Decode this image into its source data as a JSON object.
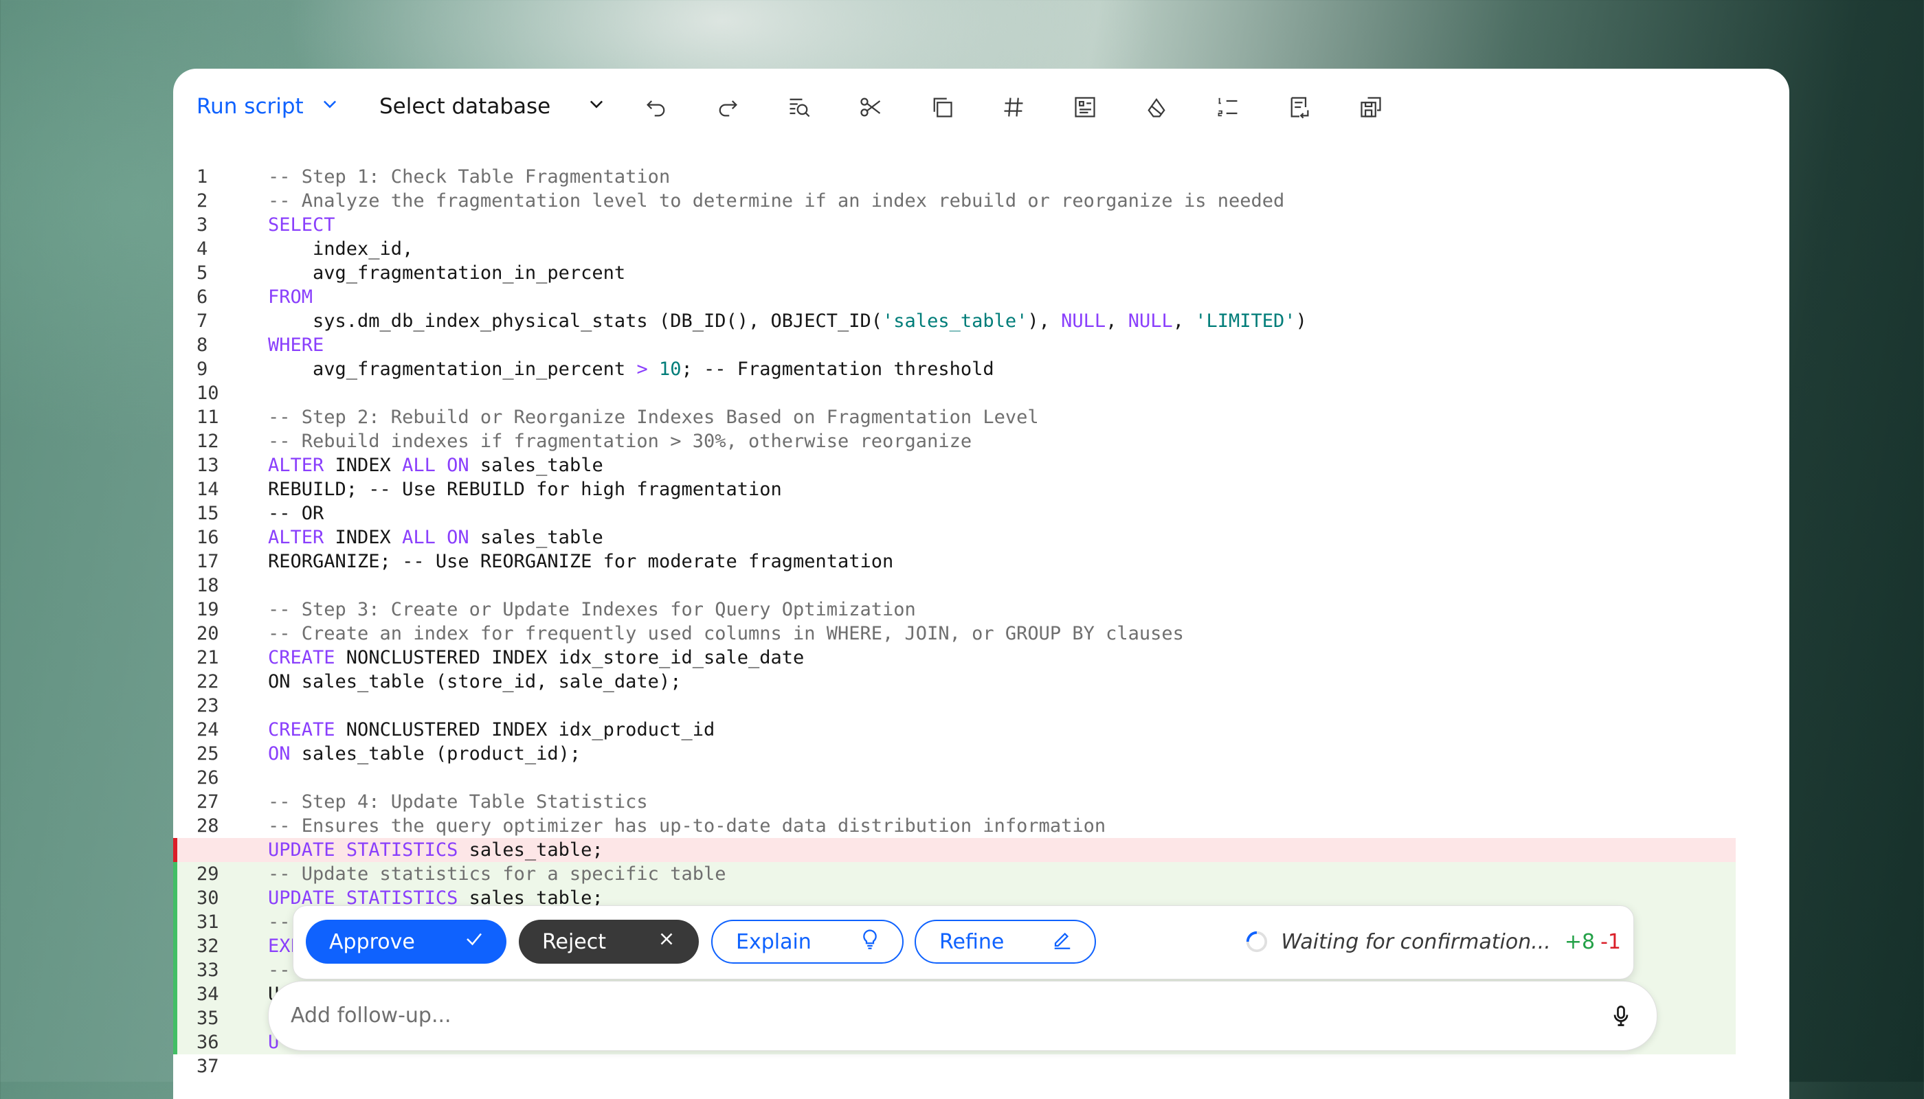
{
  "toolbar": {
    "run_label": "Run script",
    "database_label": "Select database",
    "icons": [
      "undo-icon",
      "redo-icon",
      "find-replace-icon",
      "cut-icon",
      "copy-icon",
      "hashtag-icon",
      "data-format-icon",
      "clear-format-icon",
      "list-numbered-icon",
      "document-import-icon",
      "save-as-icon"
    ]
  },
  "editor": {
    "lines": [
      {
        "n": "1",
        "type": "normal",
        "html": "<span class=\"c\">-- Step 1: Check Table Fragmentation</span>"
      },
      {
        "n": "2",
        "type": "normal",
        "html": "<span class=\"c\">-- Analyze the fragmentation level to determine if an index rebuild or reorganize is needed</span>"
      },
      {
        "n": "3",
        "type": "normal",
        "html": "<span class=\"k\">SELECT</span>"
      },
      {
        "n": "4",
        "type": "normal",
        "html": "    index_id,"
      },
      {
        "n": "5",
        "type": "normal",
        "html": "    avg_fragmentation_in_percent"
      },
      {
        "n": "6",
        "type": "normal",
        "html": "<span class=\"k\">FROM</span>"
      },
      {
        "n": "7",
        "type": "normal",
        "html": "    sys.dm_db_index_physical_stats (DB_ID(), OBJECT_ID(<span class=\"s\">'sales_table'</span>), <span class=\"k\">NULL</span>, <span class=\"k\">NULL</span>, <span class=\"s\">'LIMITED'</span>)"
      },
      {
        "n": "8",
        "type": "normal",
        "html": "<span class=\"k\">WHERE</span>"
      },
      {
        "n": "9",
        "type": "normal",
        "html": "    avg_fragmentation_in_percent <span class=\"k\">&gt;</span> <span class=\"n\">10</span>; -- Fragmentation threshold"
      },
      {
        "n": "10",
        "type": "normal",
        "html": ""
      },
      {
        "n": "11",
        "type": "normal",
        "html": "<span class=\"c\">-- Step 2: Rebuild or Reorganize Indexes Based on Fragmentation Level</span>"
      },
      {
        "n": "12",
        "type": "normal",
        "html": "<span class=\"c\">-- Rebuild indexes if fragmentation &gt; 30%, otherwise reorganize</span>"
      },
      {
        "n": "13",
        "type": "normal",
        "html": "<span class=\"k\">ALTER</span> INDEX <span class=\"k\">ALL</span> <span class=\"k\">ON</span> sales_table"
      },
      {
        "n": "14",
        "type": "normal",
        "html": "REBUILD; -- Use REBUILD for high fragmentation"
      },
      {
        "n": "15",
        "type": "normal",
        "html": "-- OR"
      },
      {
        "n": "16",
        "type": "normal",
        "html": "<span class=\"k\">ALTER</span> INDEX <span class=\"k\">ALL</span> <span class=\"k\">ON</span> sales_table"
      },
      {
        "n": "17",
        "type": "normal",
        "html": "REORGANIZE; -- Use REORGANIZE for moderate fragmentation"
      },
      {
        "n": "18",
        "type": "normal",
        "html": ""
      },
      {
        "n": "19",
        "type": "normal",
        "html": "<span class=\"c\">-- Step 3: Create or Update Indexes for Query Optimization</span>"
      },
      {
        "n": "20",
        "type": "normal",
        "html": "<span class=\"c\">-- Create an index for frequently used columns in WHERE, JOIN, or GROUP BY clauses</span>"
      },
      {
        "n": "21",
        "type": "normal",
        "html": "<span class=\"k\">CREATE</span> NONCLUSTERED INDEX idx_store_id_sale_date"
      },
      {
        "n": "22",
        "type": "normal",
        "html": "ON sales_table (store_id, sale_date);"
      },
      {
        "n": "23",
        "type": "normal",
        "html": ""
      },
      {
        "n": "24",
        "type": "normal",
        "html": "<span class=\"k\">CREATE</span> NONCLUSTERED INDEX idx_product_id"
      },
      {
        "n": "25",
        "type": "normal",
        "html": "<span class=\"k\">ON</span> sales_table (product_id);"
      },
      {
        "n": "26",
        "type": "normal",
        "html": ""
      },
      {
        "n": "27",
        "type": "normal",
        "html": "<span class=\"c\">-- Step 4: Update Table Statistics</span>"
      },
      {
        "n": "28",
        "type": "normal",
        "html": "<span class=\"c\">-- Ensures the query optimizer has up-to-date data distribution information</span>"
      },
      {
        "n": "",
        "type": "del",
        "html": "<span class=\"k\">UPDATE</span> <span class=\"k\">STATISTICS</span> sales_table;"
      },
      {
        "n": "29",
        "type": "add",
        "html": "<span class=\"c\">-- Update statistics for a specific table</span>"
      },
      {
        "n": "30",
        "type": "add",
        "html": "<span class=\"k\">UPDATE</span> <span class=\"k\">STATISTICS</span> sales_table;"
      },
      {
        "n": "31",
        "type": "add",
        "html": "<span class=\"c\">--</span>"
      },
      {
        "n": "32",
        "type": "add",
        "html": "<span class=\"k\">EXE</span>"
      },
      {
        "n": "33",
        "type": "add",
        "html": "<span class=\"c\">--</span>"
      },
      {
        "n": "34",
        "type": "add",
        "html": "U"
      },
      {
        "n": "35",
        "type": "add",
        "html": "U"
      },
      {
        "n": "36",
        "type": "add",
        "html": "<span class=\"k\">U</span>"
      },
      {
        "n": "37",
        "type": "normal",
        "html": ""
      }
    ]
  },
  "actions": {
    "approve_label": "Approve",
    "reject_label": "Reject",
    "explain_label": "Explain",
    "refine_label": "Refine",
    "status_text": "Waiting for confirmation...",
    "additions": "+8",
    "deletions": "-1"
  },
  "followup": {
    "placeholder": "Add follow-up..."
  },
  "colors": {
    "accent": "#0f62fe",
    "keyword": "#8a3ffc",
    "string": "#007d79",
    "deletion_bg": "#fde6e7",
    "addition_bg": "#eef7e9"
  }
}
